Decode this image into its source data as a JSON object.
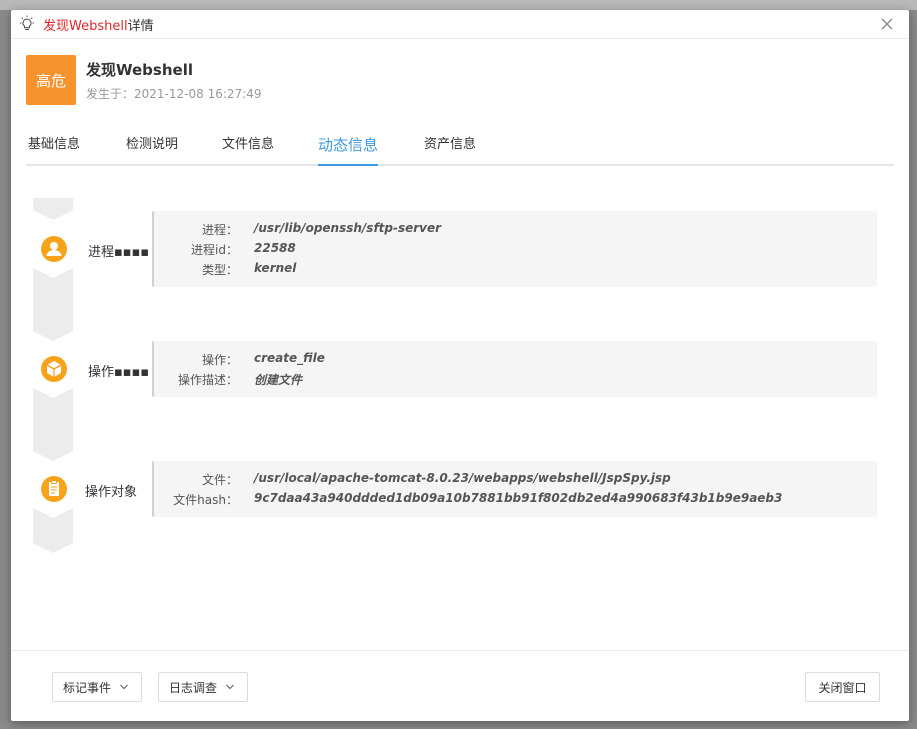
{
  "dialog": {
    "title_alert": "发现Webshell",
    "title_suffix": "详情"
  },
  "alert": {
    "severity": "高危",
    "severity_color": "#f7932d",
    "name": "发现Webshell",
    "occurred_label": "发生于：",
    "occurred_time": "2021-12-08 16:27:49"
  },
  "tabs": [
    {
      "label": "基础信息"
    },
    {
      "label": "检测说明"
    },
    {
      "label": "文件信息"
    },
    {
      "label": "动态信息",
      "active": true
    },
    {
      "label": "资产信息"
    }
  ],
  "accent_color": "#3c9ae0",
  "timeline": [
    {
      "label": "进程▪▪▪▪",
      "icon": "user-icon",
      "fields": [
        {
          "key": "进程：",
          "value": "/usr/lib/openssh/sftp-server"
        },
        {
          "key": "进程id：",
          "value": "22588"
        },
        {
          "key": "类型：",
          "value": "kernel"
        }
      ]
    },
    {
      "label": "操作▪▪▪▪",
      "icon": "cube-icon",
      "fields": [
        {
          "key": "操作：",
          "value": "create_file"
        },
        {
          "key": "操作描述：",
          "value": "创建文件"
        }
      ]
    },
    {
      "label": "操作对象",
      "icon": "clipboard-icon",
      "fields": [
        {
          "key": "文件：",
          "value": "/usr/local/apache-tomcat-8.0.23/webapps/webshell/JspSpy.jsp"
        },
        {
          "key": "文件hash：",
          "value": "9c7daa43a940ddded1db09a10b7881bb91f802db2ed4a990683f43b1b9e9aeb3"
        }
      ]
    }
  ],
  "footer": {
    "mark_event": "标记事件",
    "log_investigation": "日志调查",
    "close_window": "关闭窗口"
  }
}
